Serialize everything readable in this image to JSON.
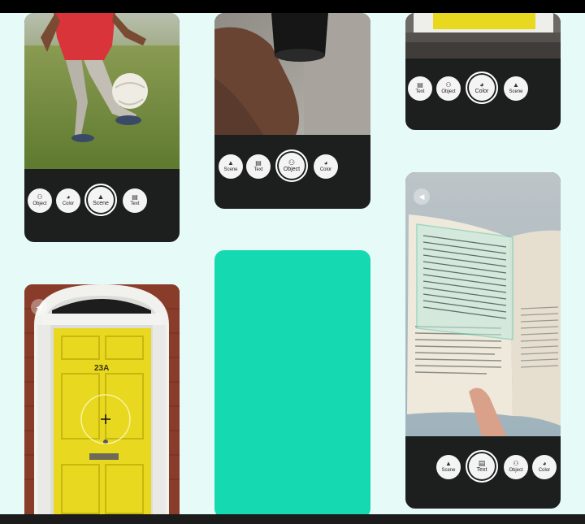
{
  "colors": {
    "background": "#e6fbf8",
    "phone": "#1d1f1f",
    "accent_card": "#15d9b0",
    "door_yellow": "#e8d81f"
  },
  "cards": {
    "football": {
      "chips": [
        {
          "label": "Object",
          "icon": "object-icon"
        },
        {
          "label": "Color",
          "icon": "palette-icon"
        },
        {
          "label": "Scene",
          "icon": "landscape-icon",
          "active": true
        },
        {
          "label": "Text",
          "icon": "document-icon"
        }
      ]
    },
    "cup": {
      "chips": [
        {
          "label": "Scene",
          "icon": "landscape-icon"
        },
        {
          "label": "Text",
          "icon": "document-icon"
        },
        {
          "label": "Object",
          "icon": "object-icon",
          "active": true
        },
        {
          "label": "Color",
          "icon": "palette-icon"
        }
      ]
    },
    "door_top": {
      "chips": [
        {
          "label": "Text",
          "icon": "document-icon"
        },
        {
          "label": "Object",
          "icon": "object-icon"
        },
        {
          "label": "Color",
          "icon": "palette-icon",
          "active": true
        },
        {
          "label": "Scene",
          "icon": "landscape-icon"
        }
      ]
    },
    "book": {
      "chips": [
        {
          "label": "Scene",
          "icon": "landscape-icon"
        },
        {
          "label": "Text",
          "icon": "document-icon",
          "active": true
        },
        {
          "label": "Object",
          "icon": "object-icon"
        },
        {
          "label": "Color",
          "icon": "palette-icon"
        }
      ]
    },
    "door": {
      "house_number": "23A"
    }
  }
}
